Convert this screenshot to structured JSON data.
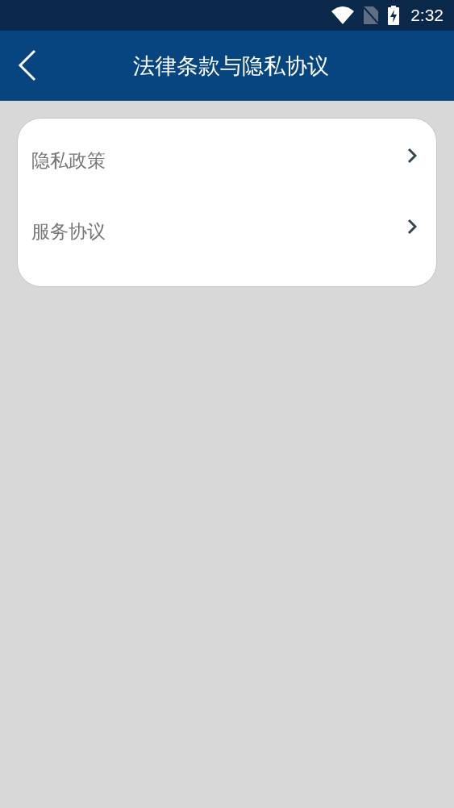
{
  "status_bar": {
    "time": "2:32"
  },
  "app_bar": {
    "title": "法律条款与隐私协议"
  },
  "menu": [
    {
      "label": "隐私政策"
    },
    {
      "label": "服务协议"
    }
  ]
}
